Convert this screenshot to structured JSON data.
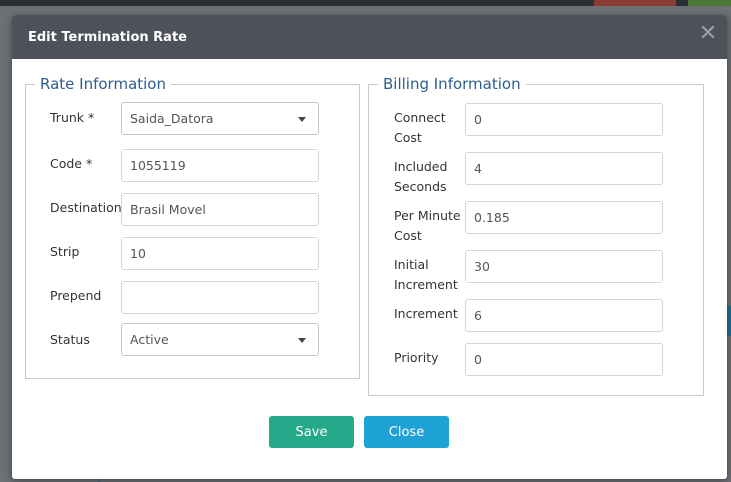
{
  "dialog": {
    "title": "Edit Termination Rate",
    "close_glyph": "✕"
  },
  "rate_info": {
    "legend": "Rate Information",
    "trunk": {
      "label": "Trunk *",
      "value": "Saida_Datora"
    },
    "code": {
      "label": "Code *",
      "value": "1055119"
    },
    "destination": {
      "label": "Destination",
      "value": "Brasil Movel"
    },
    "strip": {
      "label": "Strip",
      "value": "10"
    },
    "prepend": {
      "label": "Prepend",
      "value": ""
    },
    "status": {
      "label": "Status",
      "value": "Active"
    }
  },
  "billing_info": {
    "legend": "Billing Information",
    "connect_cost": {
      "label_line1": "Connect",
      "label_line2": "Cost",
      "value": "0"
    },
    "included_seconds": {
      "label_line1": "Included",
      "label_line2": "Seconds",
      "value": "4"
    },
    "per_minute_cost": {
      "label_line1": "Per Minute",
      "label_line2": "Cost",
      "value": "0.185"
    },
    "initial_increment": {
      "label_line1": "Initial",
      "label_line2": "Increment",
      "value": "30"
    },
    "increment": {
      "label": "Increment",
      "value": "6"
    },
    "priority": {
      "label": "Priority",
      "value": "0"
    }
  },
  "buttons": {
    "save": "Save",
    "close": "Close"
  },
  "colors": {
    "header_bg": "#4d5159",
    "legend_text": "#2e5d8f",
    "save_bg": "#26a98b",
    "close_bg": "#1fa3d7"
  }
}
